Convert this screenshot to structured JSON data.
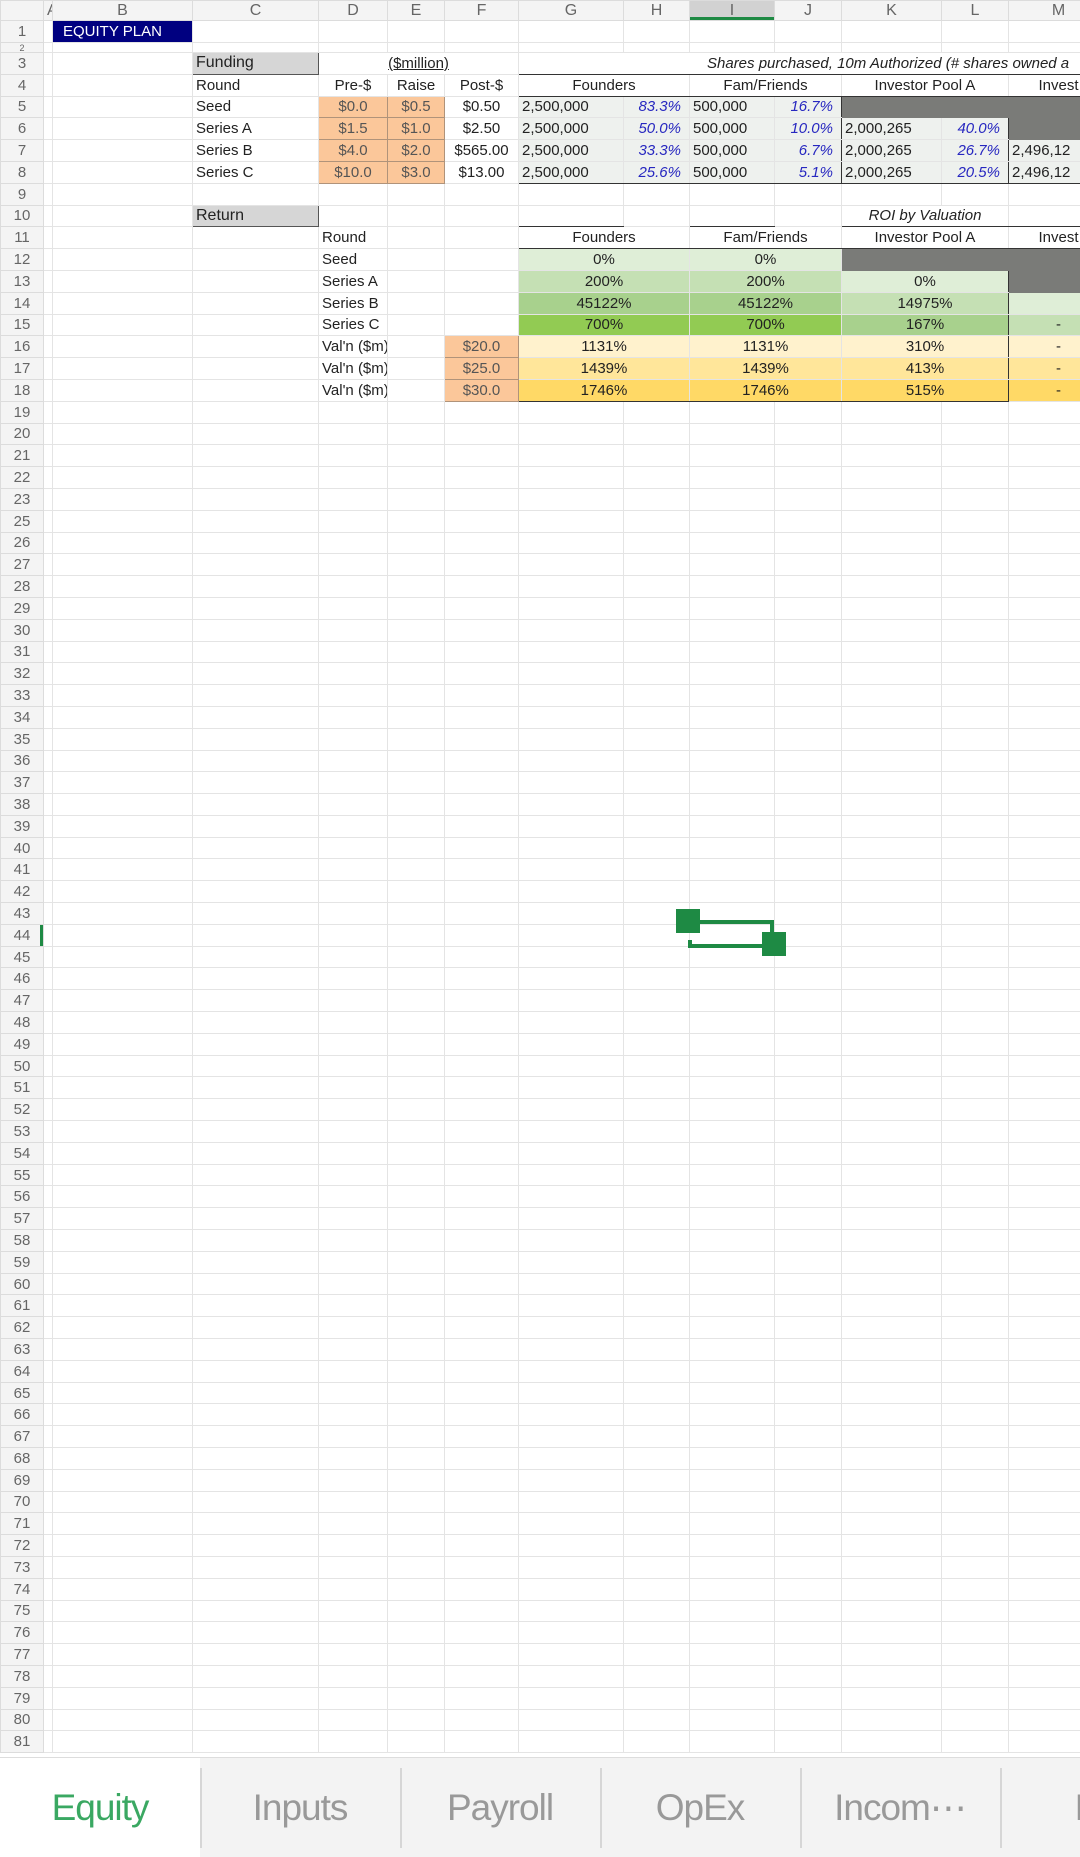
{
  "sheet": {
    "columns": [
      "A",
      "B",
      "C",
      "D",
      "E",
      "F",
      "G",
      "H",
      "I",
      "J",
      "K",
      "L",
      "M"
    ],
    "selected_column": "I",
    "selected_row": 44,
    "cells": {
      "B1": "EQUITY PLAN",
      "C3": "Funding",
      "D3": "($million)",
      "G3": "Shares purchased, 10m Authorized (# shares owned a",
      "C4": "Round",
      "D4": "Pre-$",
      "E4": "Raise",
      "F4": "Post-$",
      "G4": "Founders",
      "I4": "Fam/Friends",
      "K4": "Investor Pool A",
      "M4": "Invest",
      "C5": "Seed",
      "D5": "$0.0",
      "E5": "$0.5",
      "F5": "$0.50",
      "G5": "2,500,000",
      "H5": "83.3%",
      "I5": "500,000",
      "J5": "16.7%",
      "C6": "Series A",
      "D6": "$1.5",
      "E6": "$1.0",
      "F6": "$2.50",
      "G6": "2,500,000",
      "H6": "50.0%",
      "I6": "500,000",
      "J6": "10.0%",
      "K6": "2,000,265",
      "L6": "40.0%",
      "C7": "Series B",
      "D7": "$4.0",
      "E7": "$2.0",
      "F7": "$565.00",
      "G7": "2,500,000",
      "H7": "33.3%",
      "I7": "500,000",
      "J7": "6.7%",
      "K7": "2,000,265",
      "L7": "26.7%",
      "M7": "2,496,12",
      "C8": "Series C",
      "D8": "$10.0",
      "E8": "$3.0",
      "F8": "$13.00",
      "G8": "2,500,000",
      "H8": "25.6%",
      "I8": "500,000",
      "J8": "5.1%",
      "K8": "2,000,265",
      "L8": "20.5%",
      "M8": "2,496,12",
      "C10": "Return",
      "K10": "ROI by Valuation",
      "D11": "Round",
      "G11": "Founders",
      "I11": "Fam/Friends",
      "K11": "Investor Pool A",
      "M11": "Invest",
      "D12": "Seed",
      "G12": "0%",
      "I12": "0%",
      "D13": "Series A",
      "G13": "200%",
      "I13": "200%",
      "K13": "0%",
      "D14": "Series B",
      "G14": "45122%",
      "I14": "45122%",
      "K14": "14975%",
      "D15": "Series C",
      "G15": "700%",
      "I15": "700%",
      "K15": "167%",
      "M15": "-",
      "D16": "Val'n ($m)",
      "F16": "$20.0",
      "G16": "1131%",
      "I16": "1131%",
      "K16": "310%",
      "M16": "-",
      "D17": "Val'n ($m)",
      "F17": "$25.0",
      "G17": "1439%",
      "I17": "1439%",
      "K17": "413%",
      "M17": "-",
      "D18": "Val'n ($m)",
      "F18": "$30.0",
      "G18": "1746%",
      "I18": "1746%",
      "K18": "515%",
      "M18": "-"
    }
  },
  "tabs": [
    {
      "label": "Equity",
      "active": true
    },
    {
      "label": "Inputs",
      "active": false
    },
    {
      "label": "Payroll",
      "active": false
    },
    {
      "label": "OpEx",
      "active": false
    },
    {
      "label": "Incom⋯",
      "active": false
    },
    {
      "label": "Bal",
      "active": false
    }
  ],
  "colors": {
    "accent": "#1e8a44",
    "title_bg": "#000080",
    "input_fill": "#fbc79a",
    "tab_active": "#3aa862"
  }
}
